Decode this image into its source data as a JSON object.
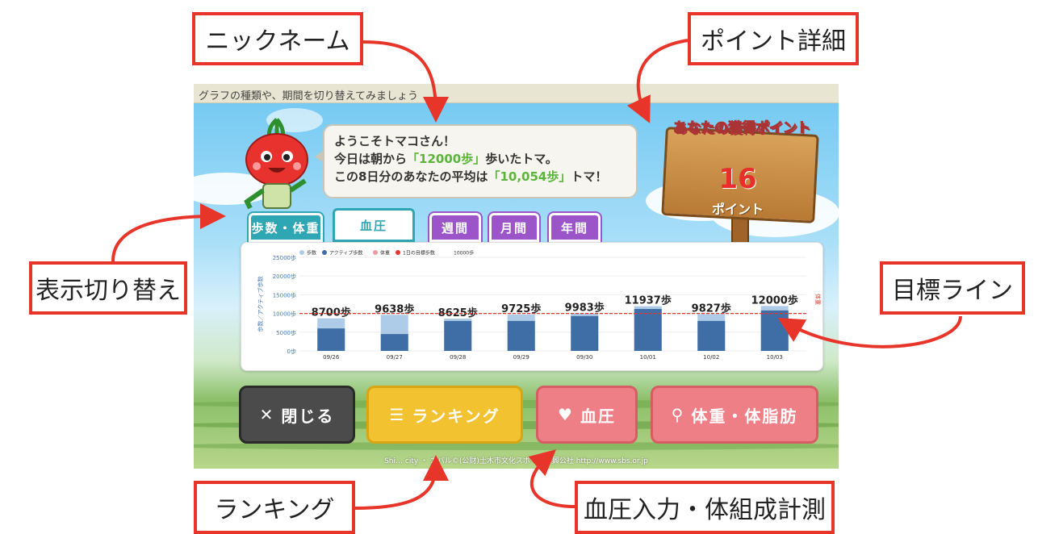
{
  "callouts": {
    "nickname": "ニックネーム",
    "point_detail": "ポイント詳細",
    "display_switch": "表示切り替え",
    "target_line": "目標ライン",
    "ranking": "ランキング",
    "bp_body": "血圧入力・体組成計測"
  },
  "app": {
    "hint": "グラフの種類や、期間を切り替えてみましょう",
    "greeting": {
      "line1": "ようこそトマコさん！",
      "line2_pre": "今日は朝から",
      "line2_val": "「12000歩」",
      "line2_post": "歩いたトマ。",
      "line3_pre": "この8日分のあなたの平均は",
      "line3_val": "「10,054歩」",
      "line3_post": "トマ！"
    },
    "points": {
      "title": "あなたの獲得ポイント",
      "value": "16",
      "unit": "ポイント"
    },
    "tabs": {
      "steps_weight": "歩数・体重",
      "blood_pressure": "血圧",
      "week": "週間",
      "month": "月間",
      "year": "年間"
    },
    "buttons": {
      "close": "閉じる",
      "ranking": "ランキング",
      "bp": "血圧",
      "weight": "体重・体脂肪"
    },
    "footer": "Shi… city ・ カバル©(公財)土木市文化スポー…振興公社 http://www.sbs.or.jp"
  },
  "colors": {
    "callout_border": "#e8352a",
    "bar_steps": "#aecbe8",
    "bar_active": "#3f6ea6",
    "target_line": "#e8352a",
    "tab_mode": "#2fa6b4",
    "tab_period": "#9b55c9",
    "btn_close": "#4b4b4b",
    "btn_ranking": "#f2c230",
    "btn_pink": "#ef7f86"
  },
  "chart_data": {
    "type": "bar",
    "legend": [
      "歩数",
      "アクティブ歩数",
      "体重",
      "1日の目標歩数",
      "10000歩"
    ],
    "ylabel": "歩数／アクティブ歩数",
    "right_label": "体重",
    "ylim": [
      0,
      25000
    ],
    "yticks": [
      "25000歩",
      "20000歩",
      "15000歩",
      "10000歩",
      "5000歩",
      "0歩"
    ],
    "categories": [
      "09/26",
      "09/27",
      "09/28",
      "09/29",
      "09/30",
      "10/01",
      "10/02",
      "10/03"
    ],
    "series": [
      {
        "name": "歩数",
        "values": [
          8700,
          9638,
          8625,
          9725,
          9983,
          11937,
          9827,
          12000
        ]
      },
      {
        "name": "アクティブ歩数",
        "values": [
          6000,
          4500,
          8000,
          8000,
          9300,
          11200,
          8000,
          10800
        ]
      }
    ],
    "data_labels": [
      "8700歩",
      "9638歩",
      "8625歩",
      "9725歩",
      "9983歩",
      "11937歩",
      "9827歩",
      "12000歩"
    ],
    "target": 10000
  }
}
